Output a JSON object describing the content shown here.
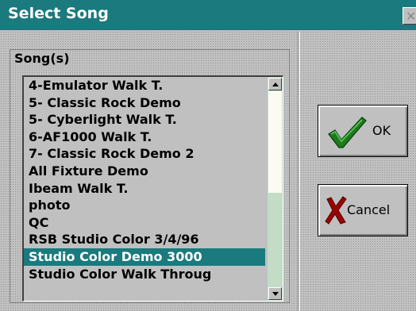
{
  "window": {
    "title": "Select Song",
    "close_glyph": "✕"
  },
  "songs_group": {
    "label": "Song(s)",
    "items": [
      "4-Emulator Walk T.",
      "5- Classic Rock Demo",
      "5- Cyberlight Walk T.",
      "6-AF1000 Walk T.",
      "7- Classic Rock Demo 2",
      "All Fixture Demo",
      "Ibeam Walk T.",
      "photo",
      "QC",
      "RSB Studio Color 3/4/96",
      "Studio Color  Demo 3000",
      "Studio Color Walk Throug"
    ],
    "selected_index": 10
  },
  "buttons": {
    "ok_label": "OK",
    "cancel_label": "Cancel",
    "ok_icon": "checkmark-icon",
    "cancel_icon": "x-mark-icon"
  },
  "colors": {
    "title_bar": "#1a7a7e",
    "selection": "#1a7a7e",
    "check": "#1e7a1e",
    "x_mark": "#a00000"
  }
}
